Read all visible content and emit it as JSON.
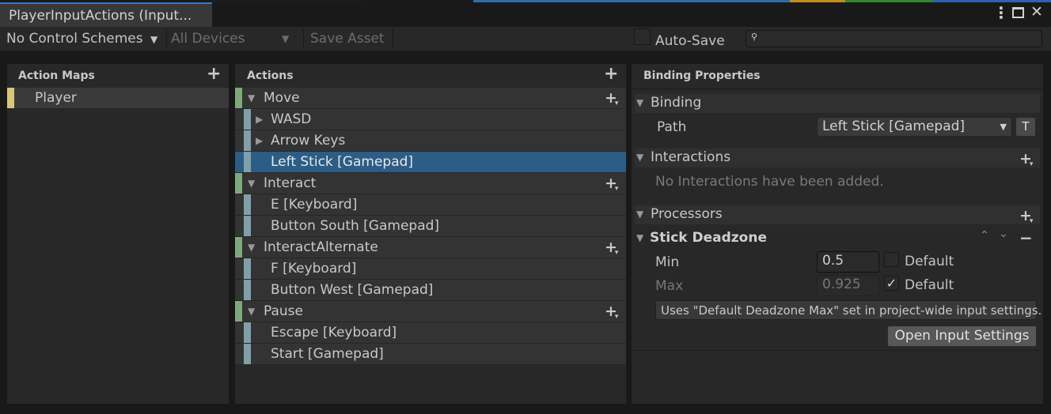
{
  "window": {
    "tab_title": "PlayerInputActions (Input...",
    "menu_icon": "kebab-menu-icon",
    "maximize_icon": "maximize-icon",
    "close_icon": "close-icon",
    "top_strip_colors": [
      "#191919",
      "#1c1c1c",
      "#2a6fa8",
      "#c58a1a",
      "#2c8a2c",
      "#3060b0"
    ]
  },
  "toolbar": {
    "control_schemes": "No Control Schemes",
    "devices": "All Devices",
    "save_asset": "Save Asset",
    "auto_save_label": "Auto-Save",
    "auto_save_checked": false,
    "search_placeholder": "",
    "search_icon": "search-icon"
  },
  "action_maps": {
    "title": "Action Maps",
    "items": [
      {
        "label": "Player",
        "color": "#d8c67a"
      }
    ]
  },
  "actions": {
    "title": "Actions",
    "rows": [
      {
        "kind": "action",
        "label": "Move",
        "expanded": true
      },
      {
        "kind": "composite",
        "label": "WASD",
        "expanded": false
      },
      {
        "kind": "composite",
        "label": "Arrow Keys",
        "expanded": false
      },
      {
        "kind": "binding",
        "label": "Left Stick [Gamepad]",
        "selected": true
      },
      {
        "kind": "action",
        "label": "Interact",
        "expanded": true
      },
      {
        "kind": "binding",
        "label": "E [Keyboard]"
      },
      {
        "kind": "binding",
        "label": "Button South [Gamepad]"
      },
      {
        "kind": "action",
        "label": "InteractAlternate",
        "expanded": true
      },
      {
        "kind": "binding",
        "label": "F [Keyboard]"
      },
      {
        "kind": "binding",
        "label": "Button West [Gamepad]"
      },
      {
        "kind": "action",
        "label": "Pause",
        "expanded": true
      },
      {
        "kind": "binding",
        "label": "Escape [Keyboard]"
      },
      {
        "kind": "binding",
        "label": "Start [Gamepad]"
      }
    ],
    "action_color": "#7fa87a",
    "binding_color": "#7fa0a8"
  },
  "binding_properties": {
    "title": "Binding Properties",
    "binding_section": "Binding",
    "path_label": "Path",
    "path_value": "Left Stick [Gamepad]",
    "t_button": "T",
    "interactions_section": "Interactions",
    "no_interactions": "No Interactions have been added.",
    "processors_section": "Processors",
    "processor_name": "Stick Deadzone",
    "min_label": "Min",
    "min_value": "0.5",
    "min_default_label": "Default",
    "min_default_checked": false,
    "max_label": "Max",
    "max_value": "0.925",
    "max_default_label": "Default",
    "max_default_checked": true,
    "note": "Uses \"Default Deadzone Max\" set in project-wide input settings.",
    "open_settings": "Open Input Settings"
  }
}
